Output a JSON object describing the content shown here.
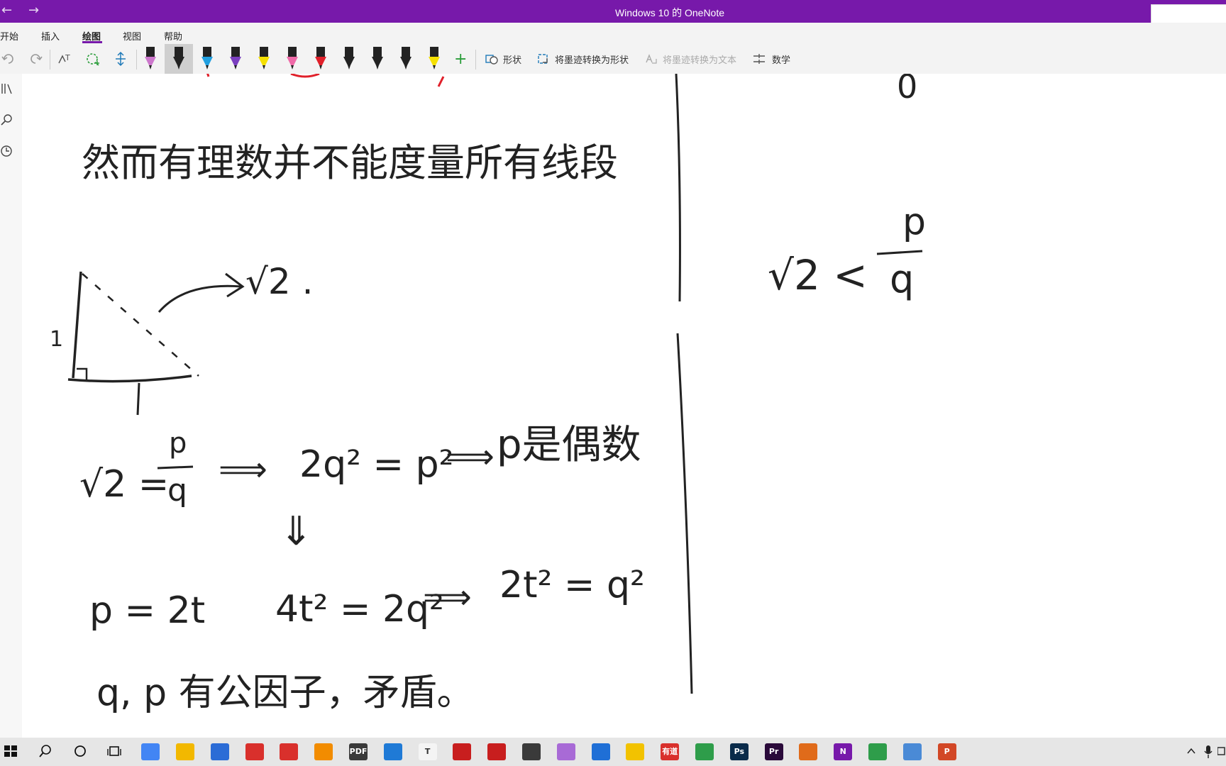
{
  "window": {
    "title": "Windows 10 的 OneNote",
    "back": "←",
    "forward": "→"
  },
  "menu": {
    "items": [
      "开始",
      "插入",
      "绘图",
      "视图",
      "帮助"
    ],
    "active": "绘图"
  },
  "ribbon": {
    "shapes_label": "形状",
    "ink_to_shape_label": "将墨迹转换为形状",
    "ink_to_text_label": "将墨迹转换为文本",
    "math_label": "数学",
    "add_pen": "+"
  },
  "pens": [
    {
      "color": "#cc77cc"
    },
    {
      "color": "#222222"
    },
    {
      "color": "#22a0e0"
    },
    {
      "color": "#7a3fbf"
    },
    {
      "color": "#f5e000"
    },
    {
      "color": "#ef6aa8"
    },
    {
      "color": "#e0202a"
    },
    {
      "color": "#222222"
    },
    {
      "color": "#222222"
    },
    {
      "color": "#222222"
    },
    {
      "color": "#f5e000"
    }
  ],
  "note": {
    "line1": "然而有理数并不能度量所有线段",
    "arrow_label": "√2 .",
    "leg_label": "1",
    "eq1_left": "√2 =",
    "frac_p": "p",
    "frac_q": "q",
    "implies": "⟹",
    "eq1_mid": "2q² = p²",
    "eq1_right": "p是偶数",
    "down_arrow": "⇓",
    "eq2_a": "p = 2t",
    "eq2_b": "4t² = 2q²",
    "eq2_c": "2t² = q²",
    "conclusion": "q, p 有公因子，矛盾。",
    "right_expr": "√2 <",
    "right_zero": "0"
  },
  "taskbar": {
    "apps": [
      "start",
      "search",
      "cortana",
      "taskview",
      "chrome",
      "explorer",
      "app-blue",
      "acrobat",
      "app-red",
      "search-tool",
      "pdf",
      "vscode",
      "typora",
      "gear",
      "virtual",
      "app-dark",
      "app-pin",
      "maps",
      "sticky",
      "youdao",
      "earth",
      "photoshop",
      "premiere",
      "firefox",
      "onenote",
      "notepad",
      "remote",
      "powerpoint"
    ],
    "labels": {
      "youdao": "有道",
      "photoshop": "Ps",
      "premiere": "Pr",
      "onenote": "N",
      "powerpoint": "P",
      "typora": "T",
      "pdf": "PDF"
    }
  },
  "colors": {
    "accent": "#7719aa",
    "ink": "#222222"
  }
}
